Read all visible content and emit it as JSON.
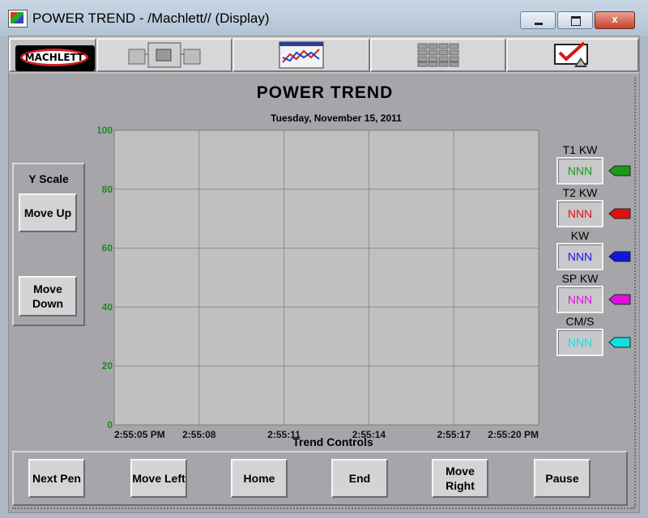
{
  "window": {
    "title": "POWER TREND - /Machlett// (Display)",
    "minimize_label": "",
    "maximize_label": "",
    "close_label": "x"
  },
  "navbar": {
    "logo_text": "MACHLETT",
    "items": [
      {
        "icon": "machine-icon"
      },
      {
        "icon": "trend-chart-icon"
      },
      {
        "icon": "grid-table-icon"
      },
      {
        "icon": "checkmark-alarm-icon"
      }
    ]
  },
  "screen": {
    "title": "POWER TREND",
    "date": "Tuesday, November 15, 2011"
  },
  "yscale": {
    "label": "Y Scale",
    "move_up": "Move Up",
    "move_down_line1": "Move",
    "move_down_line2": "Down"
  },
  "chart_data": {
    "type": "line",
    "y_ticks": [
      "100",
      "80",
      "60",
      "40",
      "20",
      "0"
    ],
    "x_ticks": [
      "2:55:05 PM",
      "2:55:08",
      "2:55:11",
      "2:55:14",
      "2:55:17",
      "2:55:20 PM"
    ],
    "ylim": [
      0,
      100
    ],
    "grid": true,
    "series": []
  },
  "legend": [
    {
      "name": "T1 KW",
      "value": "NNN",
      "color": "#1a9a1a"
    },
    {
      "name": "T2 KW",
      "value": "NNN",
      "color": "#e01010"
    },
    {
      "name": "KW",
      "value": "NNN",
      "color": "#1414e0"
    },
    {
      "name": "SP KW",
      "value": "NNN",
      "color": "#e010e0"
    },
    {
      "name": "CM/S",
      "value": "NNN",
      "color": "#10e0e0"
    }
  ],
  "controls": {
    "label": "Trend Controls",
    "buttons": [
      {
        "line1": "Next Pen",
        "line2": ""
      },
      {
        "line1": "Move Left",
        "line2": ""
      },
      {
        "line1": "Home",
        "line2": ""
      },
      {
        "line1": "End",
        "line2": ""
      },
      {
        "line1": "Move",
        "line2": "Right"
      },
      {
        "line1": "Pause",
        "line2": ""
      }
    ]
  },
  "colors": {
    "tick_green": "#1f8a1f",
    "plot_bg": "#c0c0c0",
    "grid": "#8c8c8c"
  }
}
